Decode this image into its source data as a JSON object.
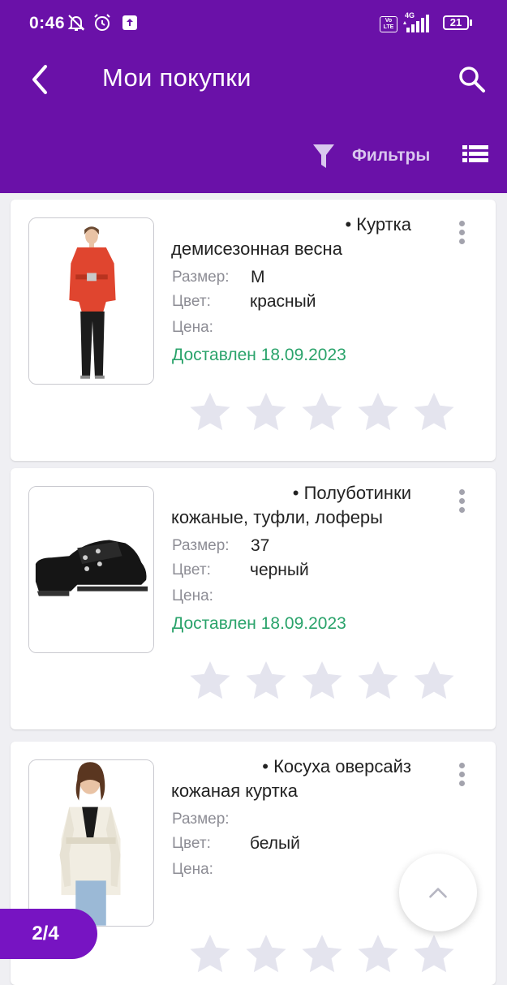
{
  "status_bar": {
    "time": "0:46",
    "volte": "Vo LTE",
    "network": "4G",
    "battery": "21"
  },
  "header": {
    "title": "Мои покупки",
    "filters_label": "Фильтры"
  },
  "labels": {
    "size": "Размер:",
    "color": "Цвет:",
    "price": "Цена:"
  },
  "items": [
    {
      "title_line1": "• Куртка",
      "title_line2": "демисезонная весна",
      "size": "M",
      "color": "красный",
      "price": "",
      "status": "Доставлен 18.09.2023"
    },
    {
      "title_line1": "• Полуботинки",
      "title_line2": "кожаные, туфли, лоферы",
      "size": "37",
      "color": "черный",
      "price": "",
      "status": "Доставлен 18.09.2023"
    },
    {
      "title_line1": "• Косуха оверсайз",
      "title_line2": "кожаная куртка",
      "size": "",
      "color": "белый",
      "price": "",
      "status": ""
    }
  ],
  "pagination": {
    "label": "2/4"
  },
  "colors": {
    "header_bg": "#6a11a8",
    "accent": "#7714c2",
    "delivered": "#2aa36b",
    "star": "#e4e4ee"
  }
}
